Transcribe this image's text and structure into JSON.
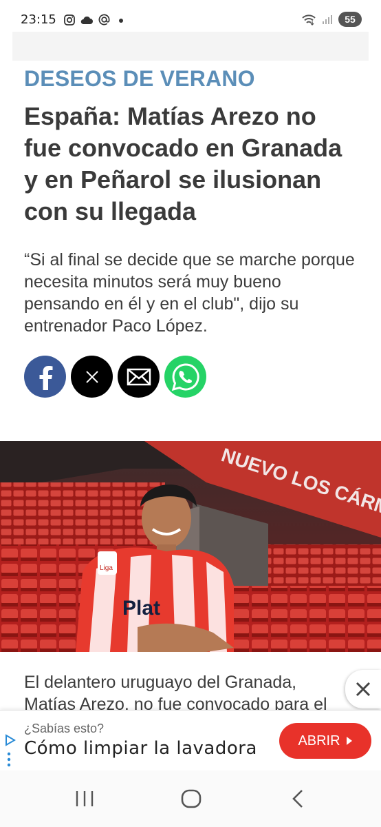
{
  "status_bar": {
    "time": "23:15",
    "battery": "55",
    "icons_left": [
      "instagram-icon",
      "cloud-icon",
      "at-icon",
      "dot-icon"
    ],
    "icons_right": [
      "wifi-icon",
      "signal-icon",
      "battery-icon"
    ]
  },
  "article": {
    "kicker": "DESEOS DE VERANO",
    "headline": "España: Matías Arezo no fue convocado en Granada y en Peñarol se ilusionan con su llegada",
    "lead": "“Si al final se decide que se marche porque necesita minutos será muy bueno pensando en él y en el club\", dijo su entrenador Paco López.",
    "body_line1": "El delantero uruguayo del Granada,",
    "body_line2": "Matías Arezo, no fue convocado para el"
  },
  "share": {
    "icons": [
      "facebook-icon",
      "x-icon",
      "mail-icon",
      "whatsapp-icon"
    ]
  },
  "hero_image": {
    "stadium_sign": "NUEVO LOS CÁRMENES",
    "shirt_text": "Plat",
    "laliga_badge": "Liga"
  },
  "ad": {
    "question": "¿Sabías esto?",
    "title": "Cómo limpiar la lavadora",
    "cta": "ABRIR"
  },
  "colors": {
    "kicker": "#5b8eb8",
    "facebook": "#3b5998",
    "whatsapp": "#25d366",
    "cta": "#e8322a"
  }
}
